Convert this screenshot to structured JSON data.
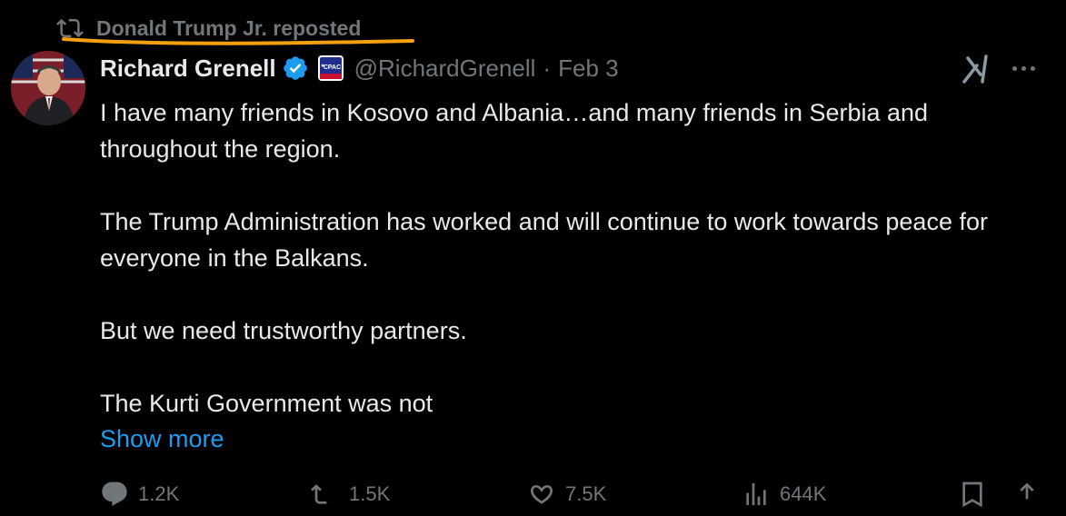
{
  "repost": {
    "label": "Donald Trump Jr. reposted",
    "icon": "repost-icon",
    "highlight_color": "#f5a10f"
  },
  "author": {
    "name": "Richard Grenell",
    "handle": "@RichardGrenell",
    "separator": "·",
    "date": "Feb 3",
    "verified_color": "#1d9bf0",
    "affiliation_badge": "CPAC"
  },
  "post": {
    "paragraphs": [
      "I have many friends in Kosovo and Albania…and many friends in Serbia and throughout the region.",
      "The Trump Administration has worked and will continue to work towards peace for everyone in the Balkans.",
      "But we need trustworthy partners.",
      "The Kurti Government was not"
    ],
    "show_more": "Show more",
    "link_color": "#1d9bf0"
  },
  "actions": {
    "replies": "1.2K",
    "reposts": "1.5K",
    "likes": "7.5K",
    "views": "644K"
  },
  "colors": {
    "background": "#000000",
    "text": "#e7e9ea",
    "secondary": "#71767b"
  }
}
